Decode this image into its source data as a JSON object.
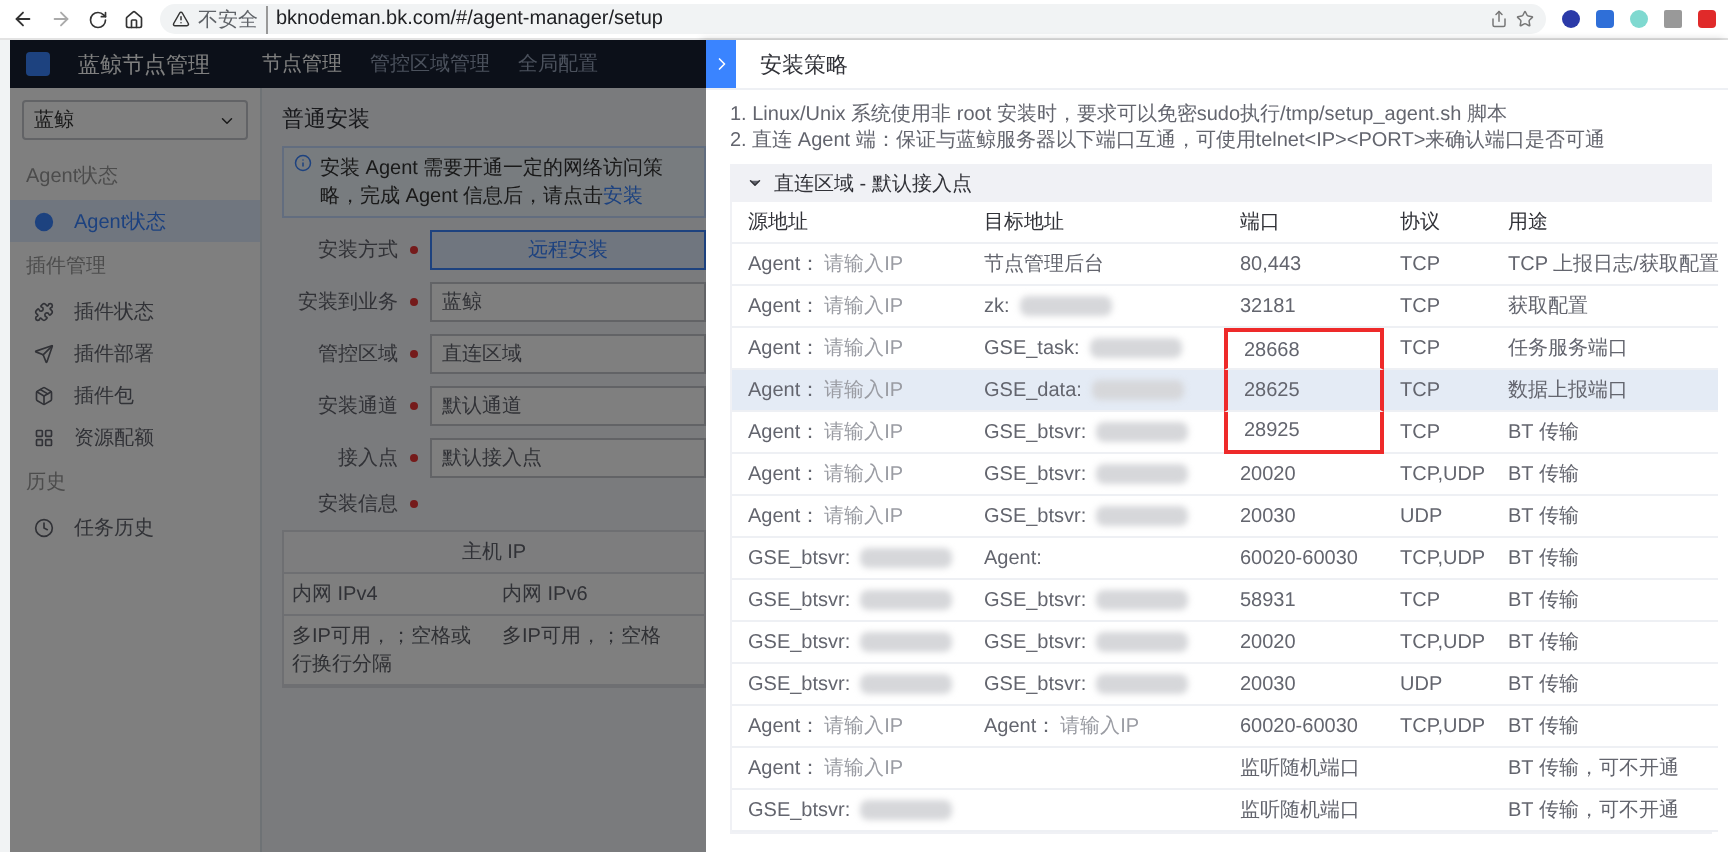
{
  "browser": {
    "security_label": "不安全",
    "url": "bknodeman.bk.com/#/agent-manager/setup"
  },
  "app": {
    "title": "蓝鲸节点管理",
    "nav": [
      {
        "label": "节点管理",
        "selected": true
      },
      {
        "label": "管控区域管理",
        "selected": false
      },
      {
        "label": "全局配置",
        "selected": false
      }
    ],
    "sidebar": {
      "business": "蓝鲸",
      "groups": [
        {
          "title": "Agent状态",
          "items": [
            {
              "label": "Agent状态",
              "selected": true
            }
          ]
        },
        {
          "title": "插件管理",
          "items": [
            {
              "label": "插件状态",
              "selected": false
            },
            {
              "label": "插件部署",
              "selected": false
            },
            {
              "label": "插件包",
              "selected": false
            },
            {
              "label": "资源配额",
              "selected": false
            }
          ]
        },
        {
          "title": "历史",
          "items": [
            {
              "label": "任务历史",
              "selected": false
            }
          ]
        }
      ]
    },
    "page": {
      "title": "普通安装",
      "notice": {
        "text": "安装 Agent 需要开通一定的网络访问策略，完成 Agent 信息后，请点击",
        "link": "安装"
      },
      "form": [
        {
          "label": "安装方式",
          "kind": "choice",
          "required": true,
          "value": "远程安装"
        },
        {
          "label": "安装到业务",
          "kind": "select",
          "required": true,
          "value": "蓝鲸"
        },
        {
          "label": "管控区域",
          "kind": "select",
          "required": true,
          "value": "直连区域"
        },
        {
          "label": "安装通道",
          "kind": "select",
          "required": true,
          "value": "默认通道"
        },
        {
          "label": "接入点",
          "kind": "select",
          "required": true,
          "value": "默认接入点"
        },
        {
          "label": "安装信息",
          "kind": "table",
          "required": true,
          "group": "主机 IP",
          "columns": [
            "内网 IPv4",
            "内网 IPv6"
          ],
          "placeholders": [
            "多IP可用，；空格或行换行分隔",
            "多IP可用，；空格"
          ]
        }
      ]
    }
  },
  "panel": {
    "title": "安装策略",
    "notes": [
      "1. Linux/Unix 系统使用非 root 安装时，要求可以免密sudo执行/tmp/setup_agent.sh 脚本",
      "2. 直连 Agent 端：保证与蓝鲸服务器以下端口互通，可使用telnet<IP><PORT>来确认端口是否可通"
    ],
    "section": {
      "title": "直连区域 - 默认接入点",
      "expanded": true,
      "columns": [
        "源地址",
        "目标地址",
        "端口",
        "协议",
        "用途"
      ],
      "rows": [
        {
          "source": {
            "label": "Agent：",
            "hint": "请输入IP"
          },
          "target": {
            "label": "节点管理后台"
          },
          "port": "80,443",
          "port_marked": false,
          "protocol": "TCP",
          "use": "TCP 上报日志/获取配置",
          "selected": false
        },
        {
          "source": {
            "label": "Agent：",
            "hint": "请输入IP"
          },
          "target": {
            "label": "zk:",
            "redacted": true
          },
          "port": "32181",
          "port_marked": false,
          "protocol": "TCP",
          "use": "获取配置",
          "selected": false
        },
        {
          "source": {
            "label": "Agent：",
            "hint": "请输入IP"
          },
          "target": {
            "label": "GSE_task:",
            "redacted": true
          },
          "port": "28668",
          "port_marked": true,
          "protocol": "TCP",
          "use": "任务服务端口",
          "selected": false
        },
        {
          "source": {
            "label": "Agent：",
            "hint": "请输入IP"
          },
          "target": {
            "label": "GSE_data:",
            "redacted": true
          },
          "port": "28625",
          "port_marked": true,
          "protocol": "TCP",
          "use": "数据上报端口",
          "selected": true
        },
        {
          "source": {
            "label": "Agent：",
            "hint": "请输入IP"
          },
          "target": {
            "label": "GSE_btsvr:",
            "redacted": true
          },
          "port": "28925",
          "port_marked": true,
          "protocol": "TCP",
          "use": "BT 传输",
          "selected": false
        },
        {
          "source": {
            "label": "Agent：",
            "hint": "请输入IP"
          },
          "target": {
            "label": "GSE_btsvr:",
            "redacted": true
          },
          "port": "20020",
          "port_marked": false,
          "protocol": "TCP,UDP",
          "use": "BT 传输",
          "selected": false
        },
        {
          "source": {
            "label": "Agent：",
            "hint": "请输入IP"
          },
          "target": {
            "label": "GSE_btsvr:",
            "redacted": true
          },
          "port": "20030",
          "port_marked": false,
          "protocol": "UDP",
          "use": "BT 传输",
          "selected": false
        },
        {
          "source": {
            "label": "GSE_btsvr:",
            "redacted": true
          },
          "target": {
            "label": "Agent:"
          },
          "port": "60020-60030",
          "port_marked": false,
          "protocol": "TCP,UDP",
          "use": "BT 传输",
          "selected": false
        },
        {
          "source": {
            "label": "GSE_btsvr:",
            "redacted": true
          },
          "target": {
            "label": "GSE_btsvr:",
            "redacted": true
          },
          "port": "58931",
          "port_marked": false,
          "protocol": "TCP",
          "use": "BT 传输",
          "selected": false
        },
        {
          "source": {
            "label": "GSE_btsvr:",
            "redacted": true
          },
          "target": {
            "label": "GSE_btsvr:",
            "redacted": true
          },
          "port": "20020",
          "port_marked": false,
          "protocol": "TCP,UDP",
          "use": "BT 传输",
          "selected": false
        },
        {
          "source": {
            "label": "GSE_btsvr:",
            "redacted": true
          },
          "target": {
            "label": "GSE_btsvr:",
            "redacted": true
          },
          "port": "20030",
          "port_marked": false,
          "protocol": "UDP",
          "use": "BT 传输",
          "selected": false
        },
        {
          "source": {
            "label": "Agent：",
            "hint": "请输入IP"
          },
          "target": {
            "label": "Agent：",
            "hint": "请输入IP"
          },
          "port": "60020-60030",
          "port_marked": false,
          "protocol": "TCP,UDP",
          "use": "BT 传输",
          "selected": false
        },
        {
          "source": {
            "label": "Agent：",
            "hint": "请输入IP"
          },
          "target": {},
          "port": "监听随机端口",
          "port_marked": false,
          "use": "BT 传输，可不开通",
          "selected": false
        },
        {
          "source": {
            "label": "GSE_btsvr:",
            "redacted": true
          },
          "target": {},
          "port": "监听随机端口",
          "port_marked": false,
          "use": "BT 传输，可不开通",
          "selected": false
        }
      ]
    }
  }
}
